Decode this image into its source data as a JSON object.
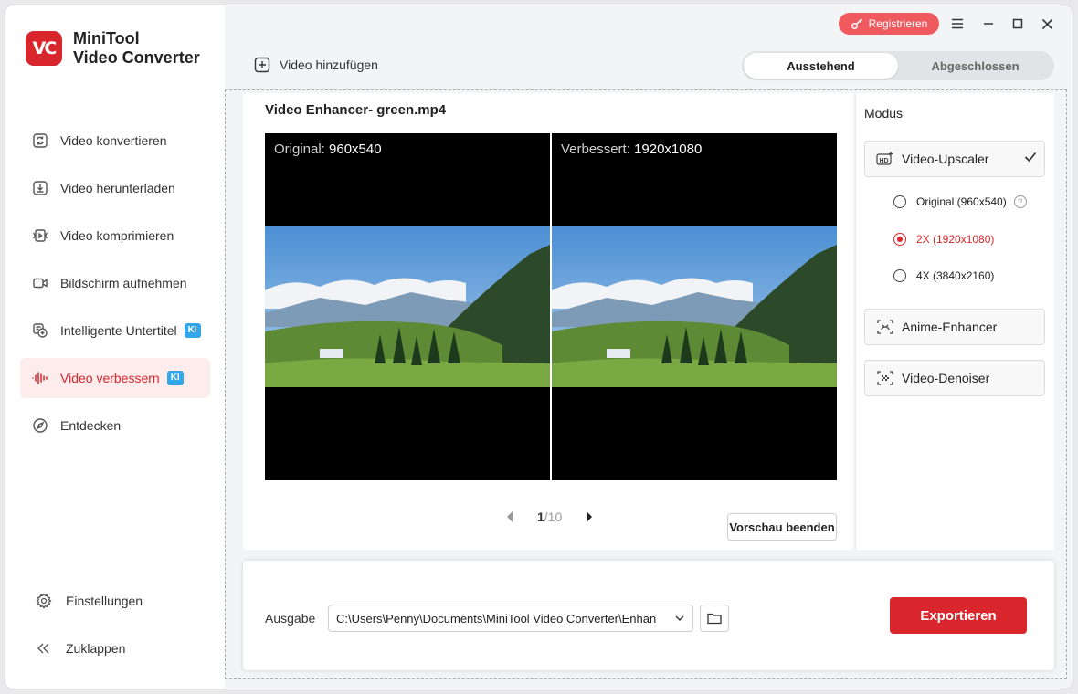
{
  "app": {
    "name_line1": "MiniTool",
    "name_line2": "Video Converter",
    "logo_text": "VC",
    "brand_color": "#d9262c"
  },
  "sidebar": {
    "items": [
      {
        "label": "Video konvertieren",
        "icon": "convert-icon"
      },
      {
        "label": "Video herunterladen",
        "icon": "download-icon"
      },
      {
        "label": "Video komprimieren",
        "icon": "compress-icon"
      },
      {
        "label": "Bildschirm aufnehmen",
        "icon": "record-icon"
      },
      {
        "label": "Intelligente Untertitel",
        "icon": "subtitle-icon",
        "badge": "KI"
      },
      {
        "label": "Video verbessern",
        "icon": "enhance-icon",
        "badge": "KI",
        "active": true
      },
      {
        "label": "Entdecken",
        "icon": "discover-icon"
      }
    ],
    "bottom": [
      {
        "label": "Einstellungen",
        "icon": "gear-icon"
      },
      {
        "label": "Zuklappen",
        "icon": "collapse-icon"
      }
    ]
  },
  "topbar": {
    "register_label": "Registrieren",
    "add_video_label": "Video hinzufügen",
    "tabs": [
      {
        "label": "Ausstehend",
        "active": true
      },
      {
        "label": "Abgeschlossen",
        "active": false
      }
    ]
  },
  "preview": {
    "title": "Video Enhancer- green.mp4",
    "original_prefix": "Original:",
    "original_res": "960x540",
    "enhanced_prefix": "Verbessert:",
    "enhanced_res": "1920x1080",
    "page_current": "1",
    "page_total": "/10",
    "stop_label": "Vorschau beenden"
  },
  "mode": {
    "title": "Modus",
    "upscaler_label": "Video-Upscaler",
    "options": [
      {
        "label": "Original (960x540)",
        "checked": false
      },
      {
        "label": "2X (1920x1080)",
        "checked": true
      },
      {
        "label": "4X (3840x2160)",
        "checked": false
      }
    ],
    "anime_label": "Anime-Enhancer",
    "denoiser_label": "Video-Denoiser"
  },
  "output": {
    "label": "Ausgabe",
    "path": "C:\\Users\\Penny\\Documents\\MiniTool Video Converter\\Enhan",
    "export_label": "Exportieren"
  }
}
